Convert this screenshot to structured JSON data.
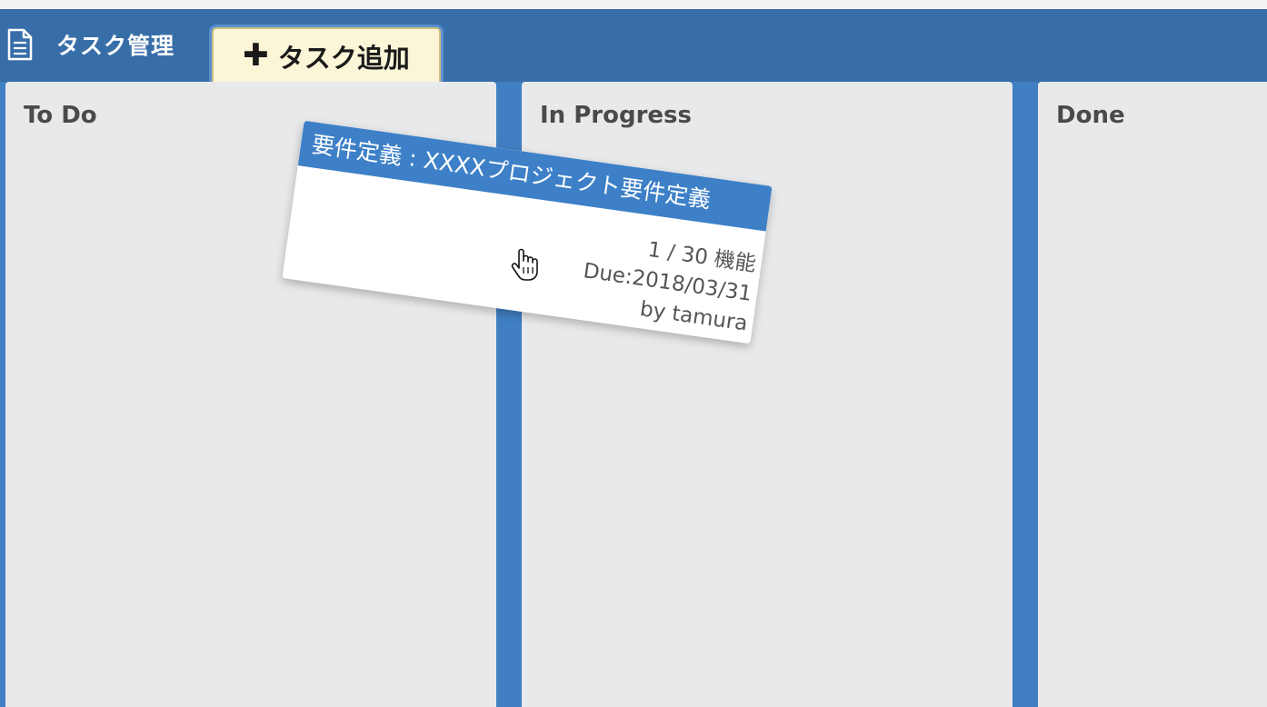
{
  "header": {
    "title": "タスク管理",
    "add_button_label": "タスク追加",
    "add_button_icon": "plus-icon",
    "doc_icon": "document-icon"
  },
  "columns": [
    {
      "title": "To Do"
    },
    {
      "title": "In Progress"
    },
    {
      "title": "Done"
    }
  ],
  "dragged_card": {
    "title": "要件定義 : XXXXプロジェクト要件定義",
    "progress": "1 / 30 機能",
    "due": "Due:2018/03/31",
    "author": "by tamura"
  },
  "colors": {
    "header_bg": "#386ea8",
    "board_bg": "#3f7fc2",
    "column_bg": "#e8e9eb",
    "card_header_bg": "#3d80c7",
    "button_bg": "#fcf6d8"
  }
}
